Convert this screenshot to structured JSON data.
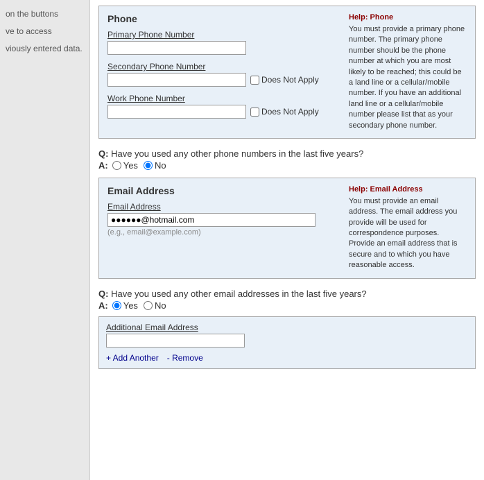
{
  "sidebar": {
    "line1": "on the buttons",
    "line2": "ve to access",
    "line3": "viously entered data."
  },
  "phone_section": {
    "title": "Phone",
    "primary_label": "Primary Phone Number",
    "primary_value": "",
    "secondary_label": "Secondary Phone Number",
    "secondary_value": "",
    "does_not_apply_1": "Does Not Apply",
    "work_label": "Work Phone Number",
    "work_value": "",
    "does_not_apply_2": "Does Not Apply"
  },
  "phone_question": {
    "q_prefix": "Q:",
    "q_text": "Have you used any other phone numbers in the last five years?",
    "a_prefix": "A:",
    "options": [
      "Yes",
      "No"
    ],
    "selected": "No"
  },
  "phone_help": {
    "title": "Help: Phone",
    "text": "You must provide a primary phone number. The primary phone number should be the phone number at which you are most likely to be reached; this could be a land line or a cellular/mobile number. If you have an additional land line or a cellular/mobile number please list that as your secondary phone number."
  },
  "email_section": {
    "title": "Email Address",
    "email_label": "Email Address",
    "email_value": "",
    "email_placeholder": "(e.g., email@example.com)"
  },
  "email_question": {
    "q_prefix": "Q:",
    "q_text": "Have you used any other email addresses in the last five years?",
    "a_prefix": "A:",
    "options": [
      "Yes",
      "No"
    ],
    "selected": "Yes"
  },
  "email_help": {
    "title": "Help: Email Address",
    "text": "You must provide an email address. The email address you provide will be used for correspondence purposes. Provide an email address that is secure and to which you have reasonable access."
  },
  "additional_email": {
    "label": "Additional Email Address",
    "value": "",
    "add_label": "+ Add Another",
    "remove_label": "- Remove"
  }
}
